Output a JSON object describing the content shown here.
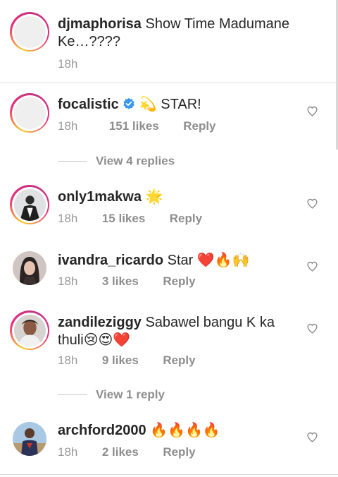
{
  "caption": {
    "username": "djmaphorisa",
    "text": "Show Time Madumane Ke…????",
    "time": "18h"
  },
  "comments": [
    {
      "username": "focalistic",
      "verified": true,
      "text": "💫 STAR!",
      "time": "18h",
      "likes": "151 likes",
      "reply": "Reply",
      "has_story_ring": true
    },
    {
      "username": "only1makwa",
      "text": "🌟",
      "time": "18h",
      "likes": "15 likes",
      "reply": "Reply",
      "has_story_ring": true
    },
    {
      "username": "ivandra_ricardo",
      "text": "Star ❤️🔥🙌",
      "time": "18h",
      "likes": "3 likes",
      "reply": "Reply",
      "has_story_ring": false
    },
    {
      "username": "zandileziggy",
      "text": "Sabawel bangu K ka thuli😢😍❤️",
      "time": "18h",
      "likes": "9 likes",
      "reply": "Reply",
      "has_story_ring": true
    },
    {
      "username": "archford2000",
      "text": "🔥🔥🔥🔥",
      "time": "18h",
      "likes": "2 likes",
      "reply": "Reply",
      "has_story_ring": false
    }
  ],
  "view_replies": [
    {
      "label": "View 4 replies"
    },
    {
      "label": "View 1 reply"
    }
  ],
  "colors": {
    "story_ring_start": "#f9ce34",
    "story_ring_mid": "#ee2a7b",
    "verified_blue": "#3897f0",
    "meta_grey": "#8e8e8e"
  },
  "icons": {
    "like": "heart-outline-icon",
    "verified": "verified-badge-icon"
  }
}
